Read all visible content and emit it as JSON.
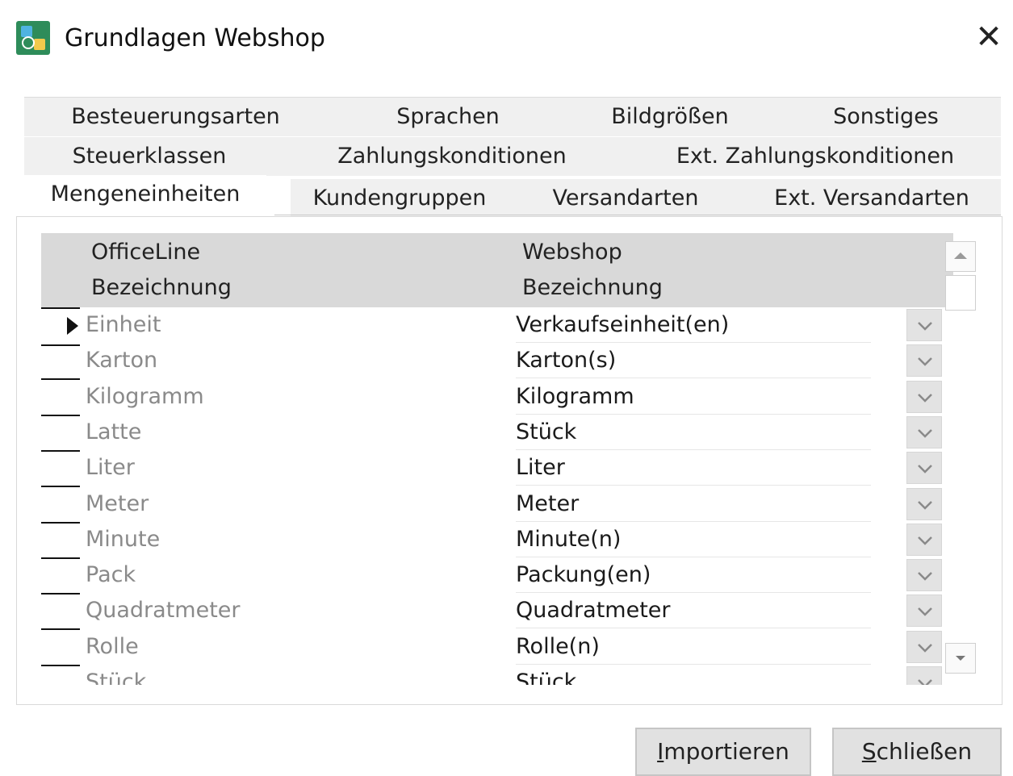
{
  "window": {
    "title": "Grundlagen Webshop"
  },
  "tabs": {
    "row1": [
      "Besteuerungsarten",
      "Sprachen",
      "Bildgrößen",
      "Sonstiges"
    ],
    "row2": [
      "Steuerklassen",
      "Zahlungskonditionen",
      "Ext. Zahlungskonditionen"
    ],
    "row3": [
      "Mengeneinheiten",
      "Kundengruppen",
      "Versandarten",
      "Ext. Versandarten"
    ],
    "active": "Mengeneinheiten"
  },
  "grid": {
    "headers": {
      "officeline_1": "OfficeLine",
      "officeline_2": "Bezeichnung",
      "webshop_1": "Webshop",
      "webshop_2": "Bezeichnung"
    },
    "rows": [
      {
        "office": "Einheit",
        "web": "Verkaufseinheit(en)"
      },
      {
        "office": "Karton",
        "web": "Karton(s)"
      },
      {
        "office": "Kilogramm",
        "web": "Kilogramm"
      },
      {
        "office": "Latte",
        "web": "Stück"
      },
      {
        "office": "Liter",
        "web": "Liter"
      },
      {
        "office": "Meter",
        "web": "Meter"
      },
      {
        "office": "Minute",
        "web": "Minute(n)"
      },
      {
        "office": "Pack",
        "web": "Packung(en)"
      },
      {
        "office": "Quadratmeter",
        "web": "Quadratmeter"
      },
      {
        "office": "Rolle",
        "web": "Rolle(n)"
      },
      {
        "office": "Stück",
        "web": "Stück"
      }
    ]
  },
  "buttons": {
    "import_mnemonic": "I",
    "import_rest": "mportieren",
    "close_mnemonic": "S",
    "close_rest": "chließen"
  },
  "icons": {
    "close": "close-icon",
    "dropdown": "chevron-down-icon",
    "scroll_up": "scroll-up-icon",
    "scroll_down": "scroll-down-icon",
    "row_indicator": "current-row-arrow-icon"
  }
}
